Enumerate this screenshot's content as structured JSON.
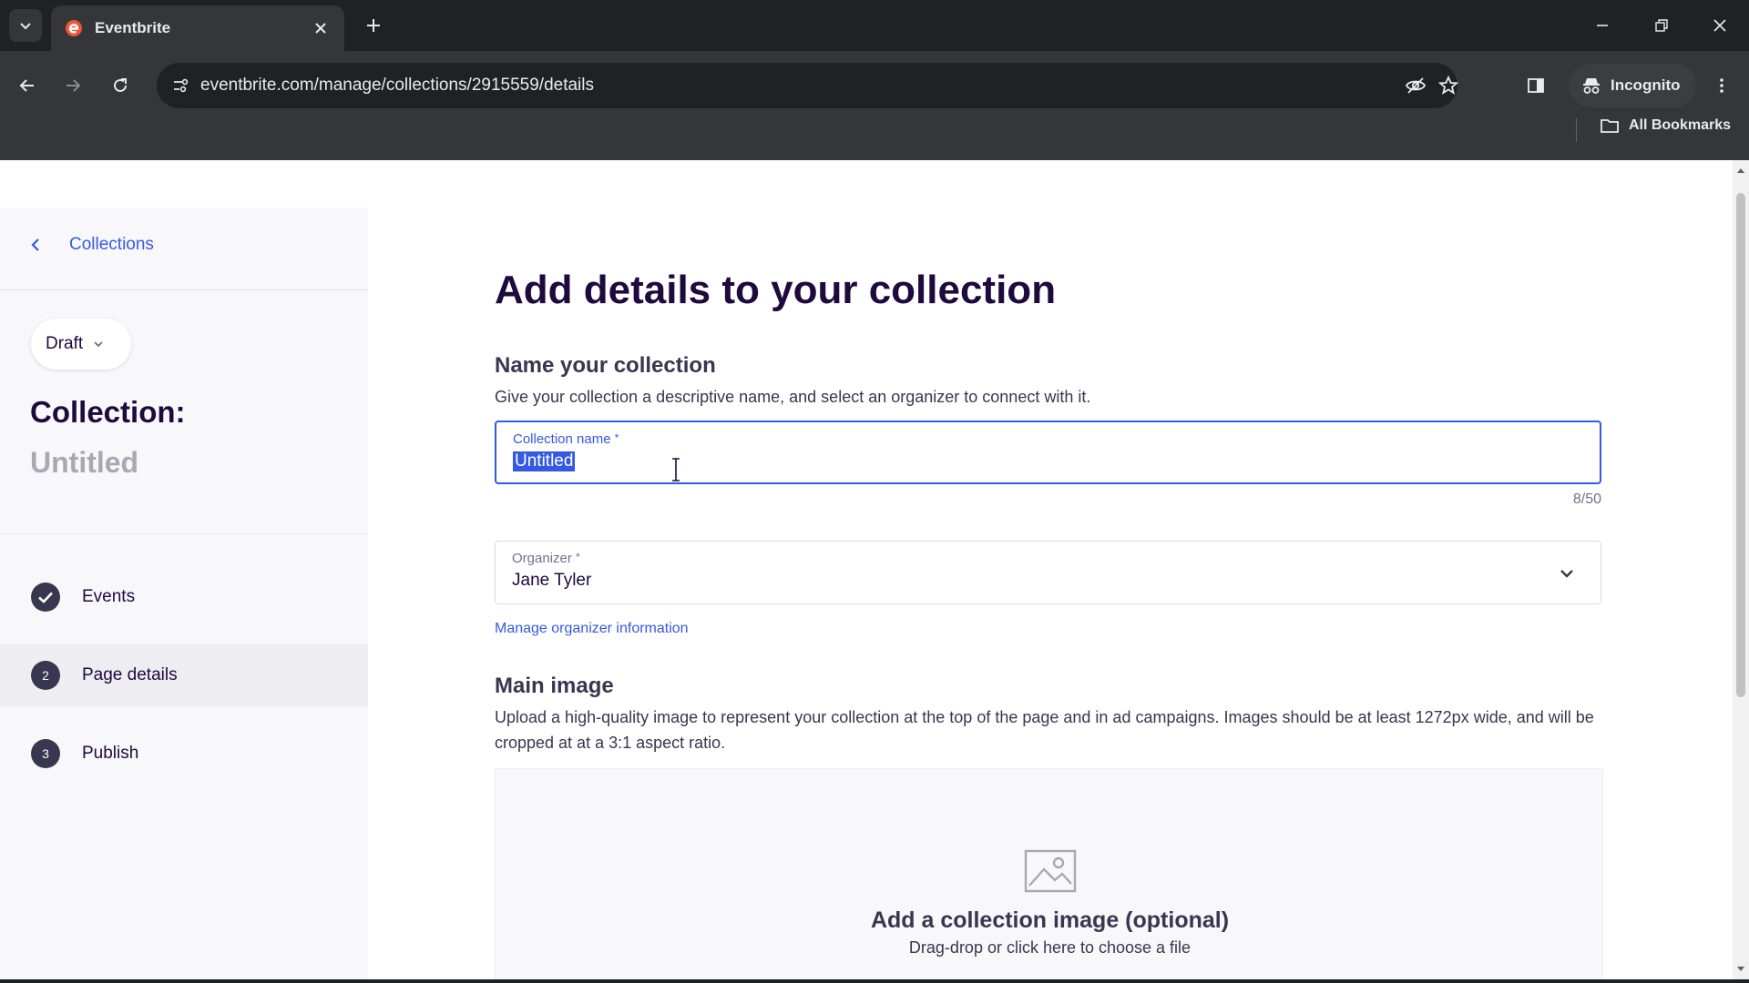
{
  "browser": {
    "tab_title": "Eventbrite",
    "url": "eventbrite.com/manage/collections/2915559/details",
    "incognito_label": "Incognito",
    "bookmarks_label": "All Bookmarks"
  },
  "sidebar": {
    "back_label": "Collections",
    "status": "Draft",
    "collection_label": "Collection:",
    "collection_name": "Untitled",
    "steps": [
      {
        "label": "Events",
        "state": "done"
      },
      {
        "label": "Page details",
        "number": "2",
        "state": "active"
      },
      {
        "label": "Publish",
        "number": "3",
        "state": "pending"
      }
    ]
  },
  "main": {
    "title": "Add details to your collection",
    "name_section": {
      "heading": "Name your collection",
      "description": "Give your collection a descriptive name, and select an organizer to connect with it.",
      "field_label": "Collection name",
      "required_mark": "*",
      "field_value": "Untitled",
      "counter": "8/50"
    },
    "organizer": {
      "label": "Organizer",
      "required_mark": "*",
      "value": "Jane Tyler",
      "manage_link": "Manage organizer information"
    },
    "image_section": {
      "heading": "Main image",
      "description": "Upload a high-quality image to represent your collection at the top of the page and in ad campaigns. Images should be at least 1272px wide, and will be cropped at at a 3:1 aspect ratio.",
      "upload_title": "Add a collection image (optional)",
      "upload_subtitle": "Drag-drop or click here to choose a file"
    }
  },
  "colors": {
    "brand": "#f05537",
    "link": "#3659e3",
    "heading": "#1e0a3c"
  }
}
